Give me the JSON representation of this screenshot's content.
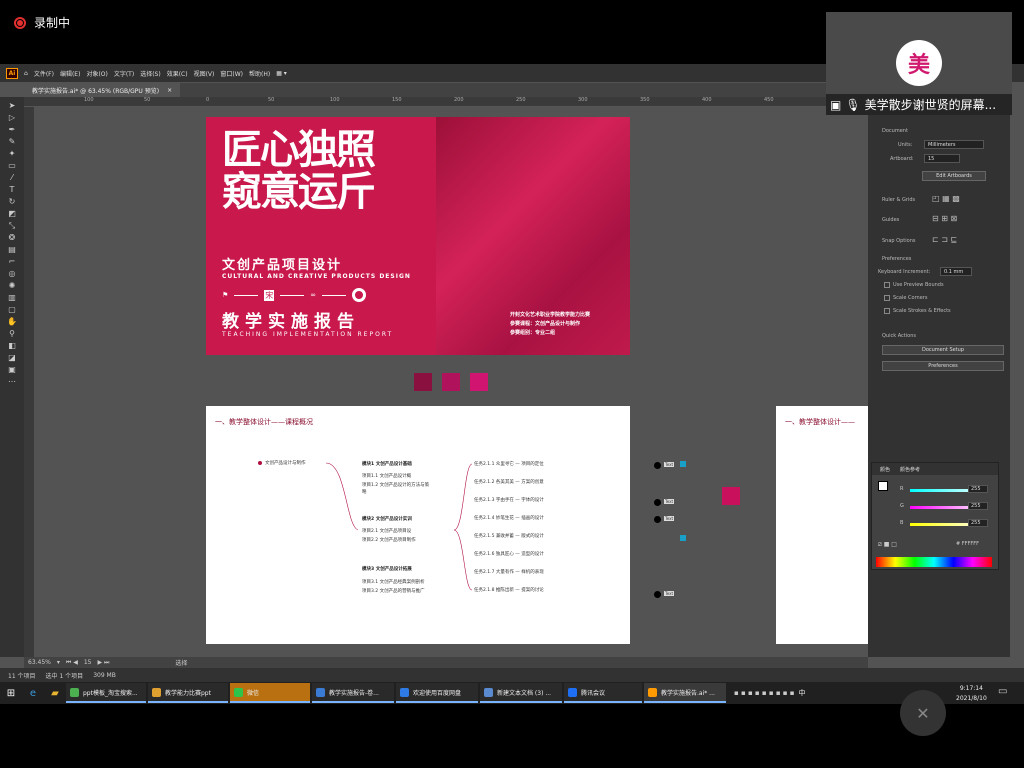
{
  "recording": {
    "label": "录制中"
  },
  "menubar": {
    "items": [
      "文件(F)",
      "编辑(E)",
      "对象(O)",
      "文字(T)",
      "选择(S)",
      "效果(C)",
      "视图(V)",
      "窗口(W)",
      "帮助(H)"
    ]
  },
  "document_tab": {
    "title": "教学实施报告.ai* @ 63.45% (RGB/GPU 预览)",
    "close": "×"
  },
  "ruler_ticks": [
    "100",
    "50",
    "0",
    "50",
    "100",
    "150",
    "200",
    "250",
    "300",
    "350",
    "400",
    "450",
    "500"
  ],
  "cover": {
    "big_title": "匠心独照\n窥意运斤",
    "subtitle": "文创产品项目设计",
    "subtitle_en": "CULTURAL AND CREATIVE PRODUCTS DESIGN",
    "report": "教学实施报告",
    "report_en": "TEACHING IMPLEMENTATION REPORT",
    "info1": "开封文化艺术职业学院教学能力比赛",
    "info2": "参赛课程：文创产品设计与制作",
    "info3": "参赛组别：专业二组",
    "seal": "宋"
  },
  "swatch_colors": [
    "#8a1040",
    "#b0125c",
    "#d01470"
  ],
  "page2": {
    "title": "一、教学整体设计——课程概况",
    "root": "文创产品设计与制作",
    "modules": [
      {
        "title": "模块1 文创产品设计基础",
        "items": [
          "项目1.1 文创产品设计概",
          "项目1.2 文创产品设计的方法与策",
          "略"
        ]
      },
      {
        "title": "模块2 文创产品设计实训",
        "items": [
          "项目2.1 文创产品项目设",
          "项目2.2 文创产品项目制作"
        ]
      },
      {
        "title": "模块3 文创产品设计拓展",
        "items": [
          "项目3.1 文创产品经典案例剖析",
          "项目3.2 文创产品的营销与推广"
        ]
      }
    ],
    "tasks": [
      "任务2.1.1 众里寻它 — 项目的定位",
      "任务2.1.2 各美其美 — 方案的创意",
      "任务2.1.3 字由手在 — 字体的设计",
      "任务2.1.4 妙笔生花 — 插画的设计",
      "任务2.1.5 兼收并蓄 — 版式的设计",
      "任务2.1.6 独具匠心 — 造型的设计",
      "任务2.1.7 大量有作 — 样机的表现",
      "任务2.1.8 推陈出新 — 提案的讨论"
    ],
    "labels": [
      "Text",
      "Text",
      "Text",
      "Text"
    ]
  },
  "page3": {
    "title": "一、教学整体设计——"
  },
  "properties": {
    "document": "Document",
    "units_label": "Units:",
    "units_value": "Millimeters",
    "artboard_label": "Artboard:",
    "artboard_value": "15",
    "edit_artboards": "Edit Artboards",
    "ruler_grids": "Ruler & Grids",
    "guides": "Guides",
    "snap_options": "Snap Options",
    "preferences": "Preferences",
    "keyboard_increment_label": "Keyboard Increment:",
    "keyboard_increment_value": "0.1 mm",
    "use_preview_bounds": "Use Preview Bounds",
    "scale_corners": "Scale Corners",
    "scale_strokes": "Scale Strokes & Effects",
    "quick_actions": "Quick Actions",
    "document_setup": "Document Setup",
    "preferences_btn": "Preferences"
  },
  "color_panel": {
    "tab1": "颜色",
    "tab2": "颜色参考",
    "r_label": "R",
    "r_value": "255",
    "g_label": "G",
    "g_value": "255",
    "b_label": "B",
    "b_value": "255",
    "hex_value": "FFFFFF",
    "r_color": "#ff0000",
    "g_color": "#00ff00",
    "b_color": "#0000ff"
  },
  "bottom_bar": {
    "zoom": "63.45%",
    "artboard": "15",
    "tool": "选择"
  },
  "status": {
    "items_count": "11 个项目",
    "selected": "选中 1 个项目",
    "memory": "309 MB"
  },
  "taskbar": {
    "items": [
      {
        "label": "ppt模板_淘宝搜索...",
        "color": "#4caf50"
      },
      {
        "label": "教学能力比赛ppt",
        "color": "#e0a030"
      },
      {
        "label": "微信",
        "color": "#2ec34a"
      },
      {
        "label": "教学实施报告-卷...",
        "color": "#3a7bd5"
      },
      {
        "label": "欢迎使用百度网盘",
        "color": "#2f7be6"
      },
      {
        "label": "新建文本文档 (3) ...",
        "color": "#5a8ad0"
      },
      {
        "label": "腾讯会议",
        "color": "#1f6ff5"
      },
      {
        "label": "教学实施报告.ai* ...",
        "color": "#ff9a00"
      }
    ],
    "ime": "中",
    "time": "9:17:14",
    "date": "2021/8/10"
  },
  "webcam": {
    "avatar_text": "美",
    "caption": "美学散步谢世贤的屏幕..."
  }
}
